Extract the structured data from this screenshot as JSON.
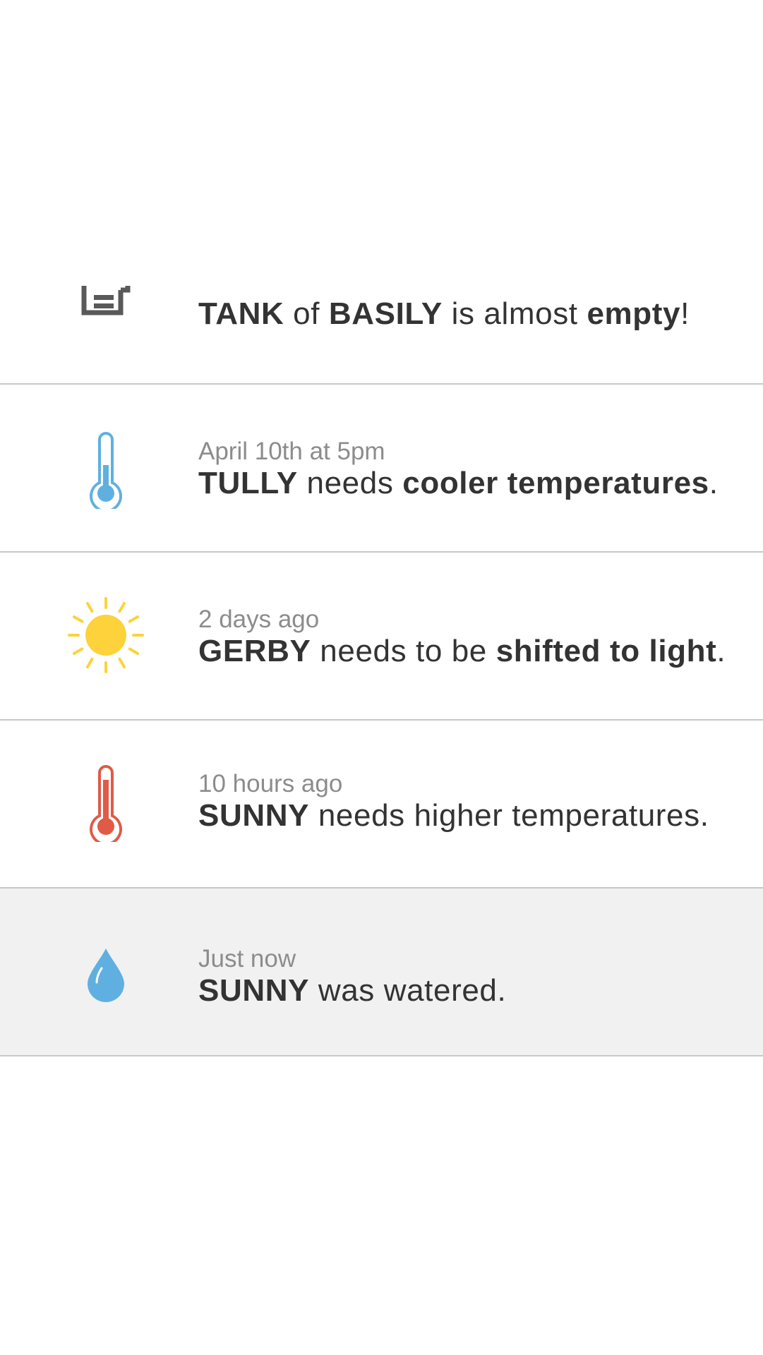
{
  "colors": {
    "divider": "#c8c8c8",
    "text": "#333333",
    "timestamp": "#8c8c8c",
    "highlight_row": "#f1f1f1",
    "cool_blue": "#5fb0e0",
    "warm_red": "#e15a47",
    "sun_yellow": "#fdd23a",
    "tank_gray": "#595959"
  },
  "notifications": [
    {
      "icon": "tank-icon",
      "time": "",
      "parts": [
        {
          "text": "TANK",
          "bold": true
        },
        {
          "text": " of ",
          "bold": false
        },
        {
          "text": "BASILY",
          "bold": true
        },
        {
          "text": " is almost ",
          "bold": false
        },
        {
          "text": "empty",
          "bold": true
        },
        {
          "text": "!",
          "bold": false
        }
      ]
    },
    {
      "icon": "thermometer-cold-icon",
      "time": "April 10th at 5pm",
      "parts": [
        {
          "text": "TULLY",
          "bold": true
        },
        {
          "text": " needs ",
          "bold": false
        },
        {
          "text": "cooler temperatures",
          "bold": true
        },
        {
          "text": ".",
          "bold": false
        }
      ]
    },
    {
      "icon": "sun-icon",
      "time": "2 days ago",
      "parts": [
        {
          "text": "GERBY",
          "bold": true
        },
        {
          "text": " needs to be ",
          "bold": false
        },
        {
          "text": "shifted to light",
          "bold": true
        },
        {
          "text": ".",
          "bold": false
        }
      ]
    },
    {
      "icon": "thermometer-hot-icon",
      "time": "10 hours ago",
      "parts": [
        {
          "text": "SUNNY",
          "bold": true
        },
        {
          "text": " needs higher temperatures.",
          "bold": false
        }
      ]
    },
    {
      "icon": "water-drop-icon",
      "time": "Just now",
      "parts": [
        {
          "text": "SUNNY",
          "bold": true
        },
        {
          "text": " was watered.",
          "bold": false
        }
      ]
    }
  ]
}
